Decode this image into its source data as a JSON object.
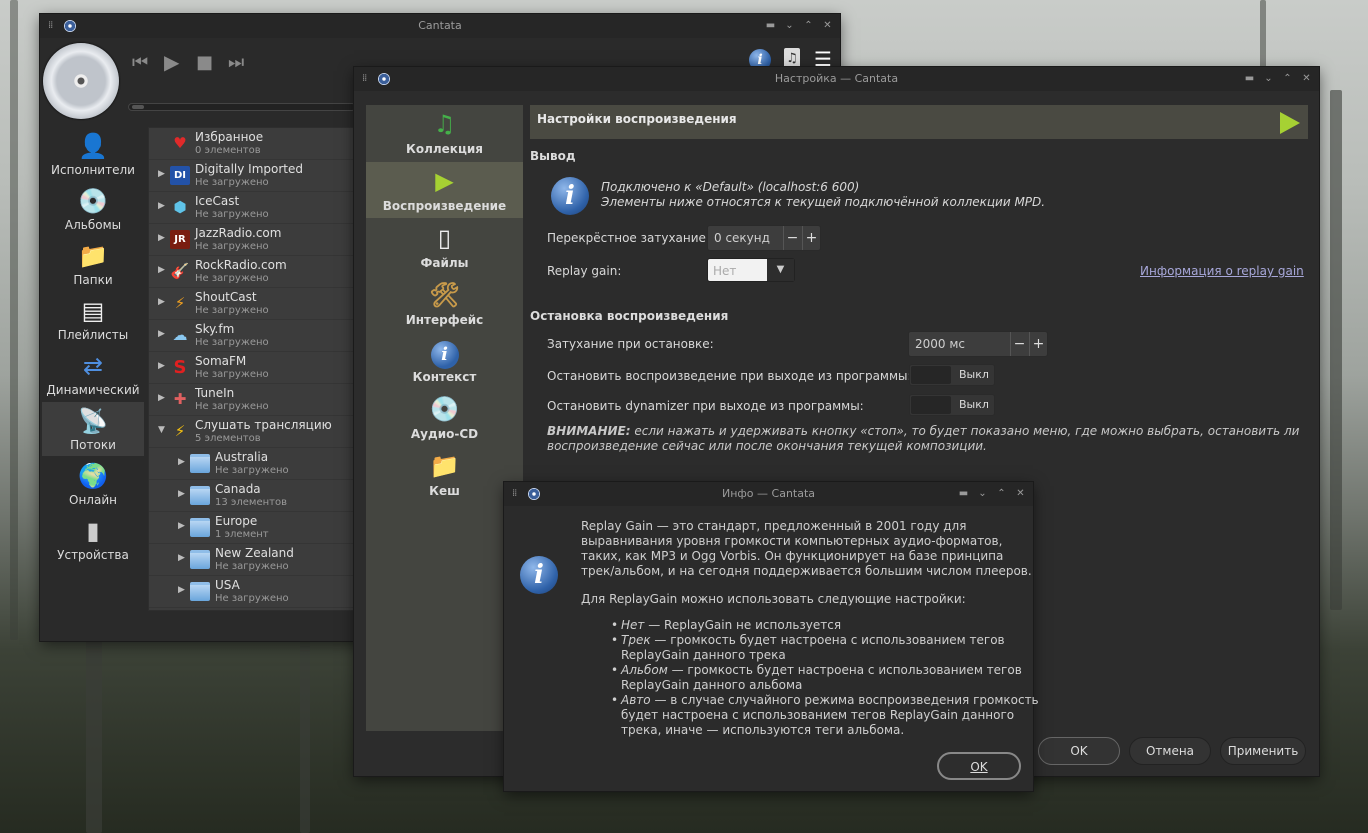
{
  "main_window": {
    "title": "Cantata",
    "nav": [
      {
        "label": "Исполнители",
        "icon": "artist-icon"
      },
      {
        "label": "Альбомы",
        "icon": "album-icon"
      },
      {
        "label": "Папки",
        "icon": "folder-icon"
      },
      {
        "label": "Плейлисты",
        "icon": "playlist-icon"
      },
      {
        "label": "Динамический",
        "icon": "shuffle-icon"
      },
      {
        "label": "Потоки",
        "icon": "stream-icon",
        "selected": true
      },
      {
        "label": "Онлайн",
        "icon": "globe-icon"
      },
      {
        "label": "Устройства",
        "icon": "ipod-icon"
      }
    ],
    "streams": [
      {
        "name": "Избранное",
        "sub": "0 элементов",
        "icon": "heart-icon"
      },
      {
        "name": "Digitally Imported",
        "sub": "Не загружено",
        "icon": "di-icon",
        "badge": "DI"
      },
      {
        "name": "IceCast",
        "sub": "Не загружено",
        "icon": "icecast-icon"
      },
      {
        "name": "JazzRadio.com",
        "sub": "Не загружено",
        "icon": "jazzradio-icon",
        "badge": "JR"
      },
      {
        "name": "RockRadio.com",
        "sub": "Не загружено",
        "icon": "guitar-icon"
      },
      {
        "name": "ShoutCast",
        "sub": "Не загружено",
        "icon": "shoutcast-icon"
      },
      {
        "name": "Sky.fm",
        "sub": "Не загружено",
        "icon": "skyfm-icon"
      },
      {
        "name": "SomaFM",
        "sub": "Не загружено",
        "icon": "somafm-icon",
        "badge": "S"
      },
      {
        "name": "TuneIn",
        "sub": "Не загружено",
        "icon": "tunein-icon"
      },
      {
        "name": "Слушать трансляцию",
        "sub": "5 элементов",
        "icon": "bolt-icon"
      },
      {
        "name": "Australia",
        "sub": "Не загружено",
        "icon": "folder-icon"
      },
      {
        "name": "Canada",
        "sub": "13 элементов",
        "icon": "folder-icon"
      },
      {
        "name": "Europe",
        "sub": "1 элемент",
        "icon": "folder-icon"
      },
      {
        "name": "New Zealand",
        "sub": "Не загружено",
        "icon": "folder-icon"
      },
      {
        "name": "USA",
        "sub": "Не загружено",
        "icon": "folder-icon"
      }
    ]
  },
  "settings_window": {
    "title": "Настройка — Cantata",
    "categories": [
      {
        "label": "Коллекция",
        "icon": "music-note-icon"
      },
      {
        "label": "Воспроизведение",
        "icon": "play-icon",
        "selected": true
      },
      {
        "label": "Файлы",
        "icon": "file-icon"
      },
      {
        "label": "Интерфейс",
        "icon": "tools-icon"
      },
      {
        "label": "Контекст",
        "icon": "info-icon"
      },
      {
        "label": "Аудио-CD",
        "icon": "cd-icon"
      },
      {
        "label": "Кеш",
        "icon": "folder-icon"
      }
    ],
    "panel_title": "Настройки воспроизведения",
    "output_section": "Вывод",
    "connected_line1": "Подключено к «Default» (localhost:6 600)",
    "connected_line2": "Элементы ниже относятся к текущей подключённой коллекции MPD.",
    "crossfade_label": "Перекрёстное затухание:",
    "crossfade_value": "0 секунд",
    "replaygain_label": "Replay gain:",
    "replaygain_value": "Нет",
    "replaygain_link": "Информация о replay gain",
    "stop_section": "Остановка воспроизведения",
    "fadeout_label": "Затухание при остановке:",
    "fadeout_value": "2000 мс",
    "stop_on_exit_label": "Остановить воспроизведение при выходе из программы:",
    "stop_on_exit_value": "Выкл",
    "stop_dynamizer_label": "Остановить dynamizer при выходе из программы:",
    "stop_dynamizer_value": "Выкл",
    "warning_bold": "ВНИМАНИЕ:",
    "warning_line1": "если нажать и удерживать кнопку «стоп», то будет показано меню, где можно выбрать, остановить ли",
    "warning_line2": "воспроизведение сейчас или после окончания текущей композиции.",
    "ok": "OK",
    "cancel": "Отмена",
    "apply": "Применить"
  },
  "info_dialog": {
    "title": "Инфо — Cantata",
    "para1": [
      "Replay Gain — это стандарт, предложенный в 2001 году для",
      "выравнивания уровня громкости компьютерных аудио-форматов,",
      "таких, как MP3 и Ogg Vorbis. Он функционирует на базе принципа",
      "трек/альбом, и на сегодня поддерживается большим числом плееров."
    ],
    "para2": "Для ReplayGain можно использовать следующие настройки:",
    "bullets": [
      {
        "term": "Нет",
        "lines": [
          "— ReplayGain не используется"
        ]
      },
      {
        "term": "Трек",
        "lines": [
          "— громкость будет настроена с использованием тегов",
          "ReplayGain данного трека"
        ]
      },
      {
        "term": "Альбом",
        "lines": [
          "— громкость будет настроена с использованием тегов",
          "ReplayGain данного альбома"
        ]
      },
      {
        "term": "Авто",
        "lines": [
          "— в случае случайного режима воспроизведения громкость",
          "будет настроена с использованием тегов ReplayGain данного",
          "трека, иначе — используются теги альбома."
        ]
      }
    ],
    "ok": "OK"
  }
}
